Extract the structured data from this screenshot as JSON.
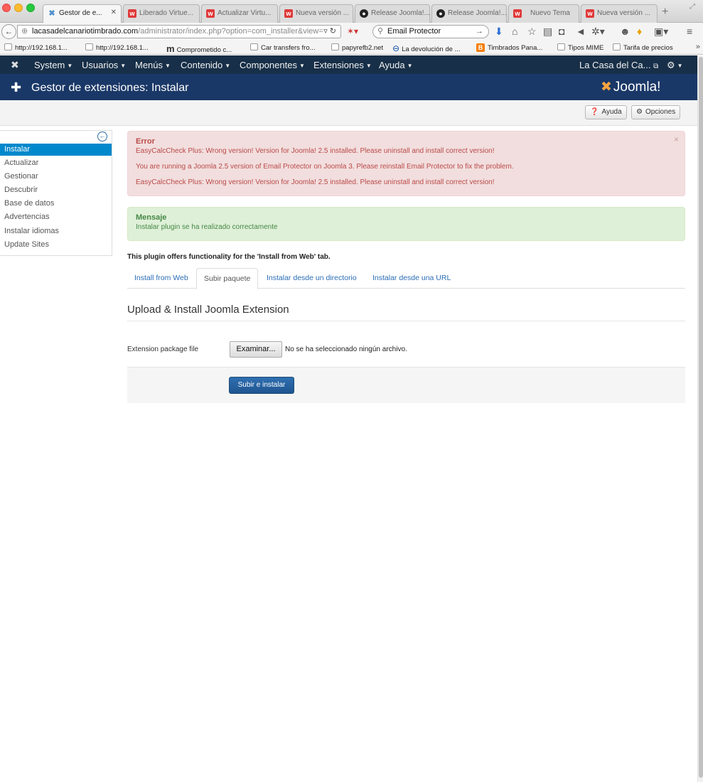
{
  "browser": {
    "tabs": [
      {
        "label": "Gestor de e...",
        "favicon": "joomla",
        "active": true
      },
      {
        "label": "Liberado Virtue...",
        "favicon": "w"
      },
      {
        "label": "Actualizar Virtu...",
        "favicon": "w"
      },
      {
        "label": "Nueva versión ...",
        "favicon": "w"
      },
      {
        "label": "Release Joomla!...",
        "favicon": "github"
      },
      {
        "label": "Release Joomla!...",
        "favicon": "github"
      },
      {
        "label": "Nuevo Tema",
        "favicon": "w"
      },
      {
        "label": "Nueva versión ...",
        "favicon": "w"
      }
    ],
    "url_host": "lacasadelcanariotimbrado.com",
    "url_path": "/administrator/index.php?option=com_installer&view=",
    "search_value": "Email Protector",
    "bookmarks": [
      {
        "label": "http://192.168.1...",
        "icon": "page"
      },
      {
        "label": "http://192.168.1...",
        "icon": "page"
      },
      {
        "label": "Comprometido c...",
        "icon": "m"
      },
      {
        "label": "Car transfers fro...",
        "icon": "page"
      },
      {
        "label": "papyrefb2.net",
        "icon": "page"
      },
      {
        "label": "La devolución de ...",
        "icon": "o"
      },
      {
        "label": "Timbrados Pana...",
        "icon": "blogger"
      },
      {
        "label": "Tipos MIME",
        "icon": "page"
      },
      {
        "label": "Tarifa de precios",
        "icon": "page"
      }
    ]
  },
  "joomla": {
    "menu": [
      "System",
      "Usuarios",
      "Menús",
      "Contenido",
      "Componentes",
      "Extensiones",
      "Ayuda"
    ],
    "site_name": "La Casa del Ca...",
    "page_title": "Gestor de extensiones: Instalar",
    "brand": "Joomla!",
    "toolbar": {
      "help": "Ayuda",
      "options": "Opciones"
    },
    "sidebar": [
      {
        "label": "Instalar",
        "active": true
      },
      {
        "label": "Actualizar"
      },
      {
        "label": "Gestionar"
      },
      {
        "label": "Descubrir"
      },
      {
        "label": "Base de datos"
      },
      {
        "label": "Advertencias"
      },
      {
        "label": "Instalar idiomas"
      },
      {
        "label": "Update Sites"
      }
    ],
    "error": {
      "heading": "Error",
      "messages": [
        "EasyCalcCheck Plus: Wrong version! Version for Joomla! 2.5 installed. Please uninstall and install correct version!",
        "You are running a Joomla 2.5 version of Email Protector on Joomla 3. Please reinstall Email Protector to fix the problem.",
        "EasyCalcCheck Plus: Wrong version! Version for Joomla! 2.5 installed. Please uninstall and install correct version!"
      ]
    },
    "success": {
      "heading": "Mensaje",
      "message": "Instalar plugin se ha realizado correctamente"
    },
    "plugin_note": "This plugin offers functionality for the 'Install from Web' tab.",
    "tabs": [
      {
        "label": "Install from Web"
      },
      {
        "label": "Subir paquete",
        "active": true
      },
      {
        "label": "Instalar desde un directorio"
      },
      {
        "label": "Instalar desde una URL"
      }
    ],
    "section_title": "Upload & Install Joomla Extension",
    "field_label": "Extension package file",
    "file_button": "Examinar...",
    "file_status": "No se ha seleccionado ningún archivo.",
    "submit": "Subir e instalar"
  },
  "colors": {
    "navbar": "#172f48",
    "header": "#1a3867",
    "active_sidebar": "#0088cc",
    "error_text": "#b94a48",
    "success_text": "#468847",
    "primary_button": "#2f6fb1"
  }
}
